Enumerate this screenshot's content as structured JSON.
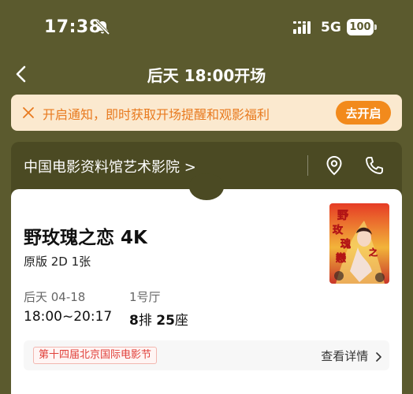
{
  "status": {
    "time": "17:38",
    "network": "5G",
    "battery": "100"
  },
  "nav": {
    "title": "后天 18:00开场"
  },
  "banner": {
    "text": "开启通知，即时获取开场提醒和观影福利",
    "button_label": "去开启"
  },
  "cinema": {
    "name": "中国电影资料馆艺术影院 >"
  },
  "ticket": {
    "movie_title": "野玫瑰之恋 4K",
    "format": "原版 2D 1张",
    "date_label": "后天 04-18",
    "hall": "1号厅",
    "time_range": "18:00~20:17",
    "row": "8",
    "row_unit": "排",
    "seat": "25",
    "seat_unit": "座",
    "poster_title": "野玫瑰之戀"
  },
  "festival": {
    "tag": "第十四届北京国际电影节",
    "details_label": "查看详情"
  },
  "colors": {
    "background": "#5b5a2e",
    "accent": "#f28a1c",
    "banner_bg": "#fbe9cf",
    "tag_red": "#e0403a"
  }
}
